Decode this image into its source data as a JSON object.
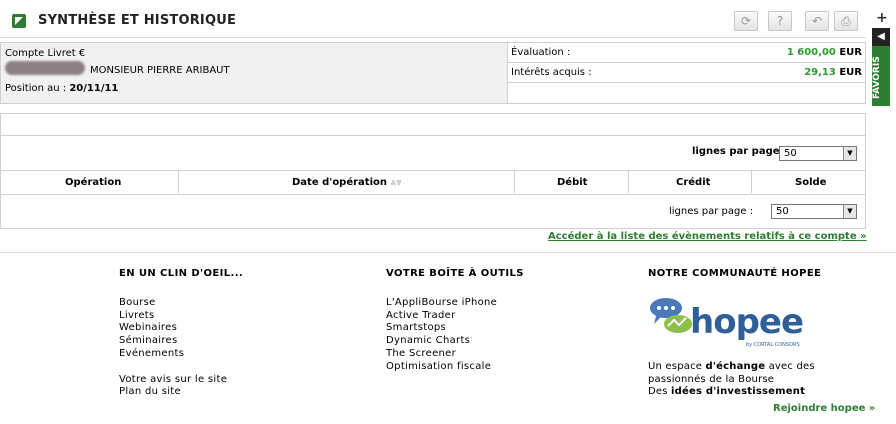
{
  "panel": {
    "title": "SYNTHÈSE ET HISTORIQUE",
    "icons": [
      "refresh-icon",
      "help-icon",
      "reply-icon",
      "print-icon"
    ]
  },
  "sidebar": {
    "plus": "+",
    "arrow": "◀",
    "favoris": "FAVORIS"
  },
  "account": {
    "type": "Compte Livret €",
    "holder": "MONSIEUR PIERRE ARIBAUT",
    "position_label": "Position au :",
    "position_date": "20/11/11"
  },
  "valuation": {
    "eval_label": "Évaluation :",
    "eval_value": "1 600,00",
    "interest_label": "Intérêts acquis :",
    "interest_value": "29,13",
    "currency": "EUR"
  },
  "table": {
    "lines_per_page_label": "lignes par page :",
    "lines_per_page_value": "50",
    "columns": [
      "Opération",
      "Date d'opération",
      "Débit",
      "Crédit",
      "Solde"
    ],
    "sort_icons": "⩓⩔"
  },
  "events_link": "Accéder à la liste des évènements relatifs à ce compte",
  "footer": {
    "col1": {
      "title": "EN UN CLIN D'OEIL...",
      "links": [
        "Bourse",
        "Livrets",
        "Webinaires",
        "Séminaires",
        "Evénements"
      ],
      "links2": [
        "Votre avis sur le site",
        "Plan du site"
      ]
    },
    "col2": {
      "title": "VOTRE BOÎTE À OUTILS",
      "links": [
        "L'AppliBourse iPhone",
        "Active Trader",
        "Smartstops",
        "Dynamic Charts",
        "The Screener",
        "Optimisation fiscale"
      ]
    },
    "col3": {
      "title": "NOTRE COMMUNAUTÉ HOPEE",
      "logo_text": "hopee",
      "logo_sub": "by CORTAL CONSORS",
      "desc1_a": "Un espace ",
      "desc1_b": "d'échange",
      "desc1_c": " avec des",
      "desc2": "passionnés de la Bourse",
      "desc3_a": "Des ",
      "desc3_b": "idées d'investissement",
      "join": "Rejoindre hopee"
    }
  },
  "colors": {
    "green": "#2e7d32",
    "value_green": "#2e9a2e",
    "hopee_blue": "#2e5f99"
  }
}
